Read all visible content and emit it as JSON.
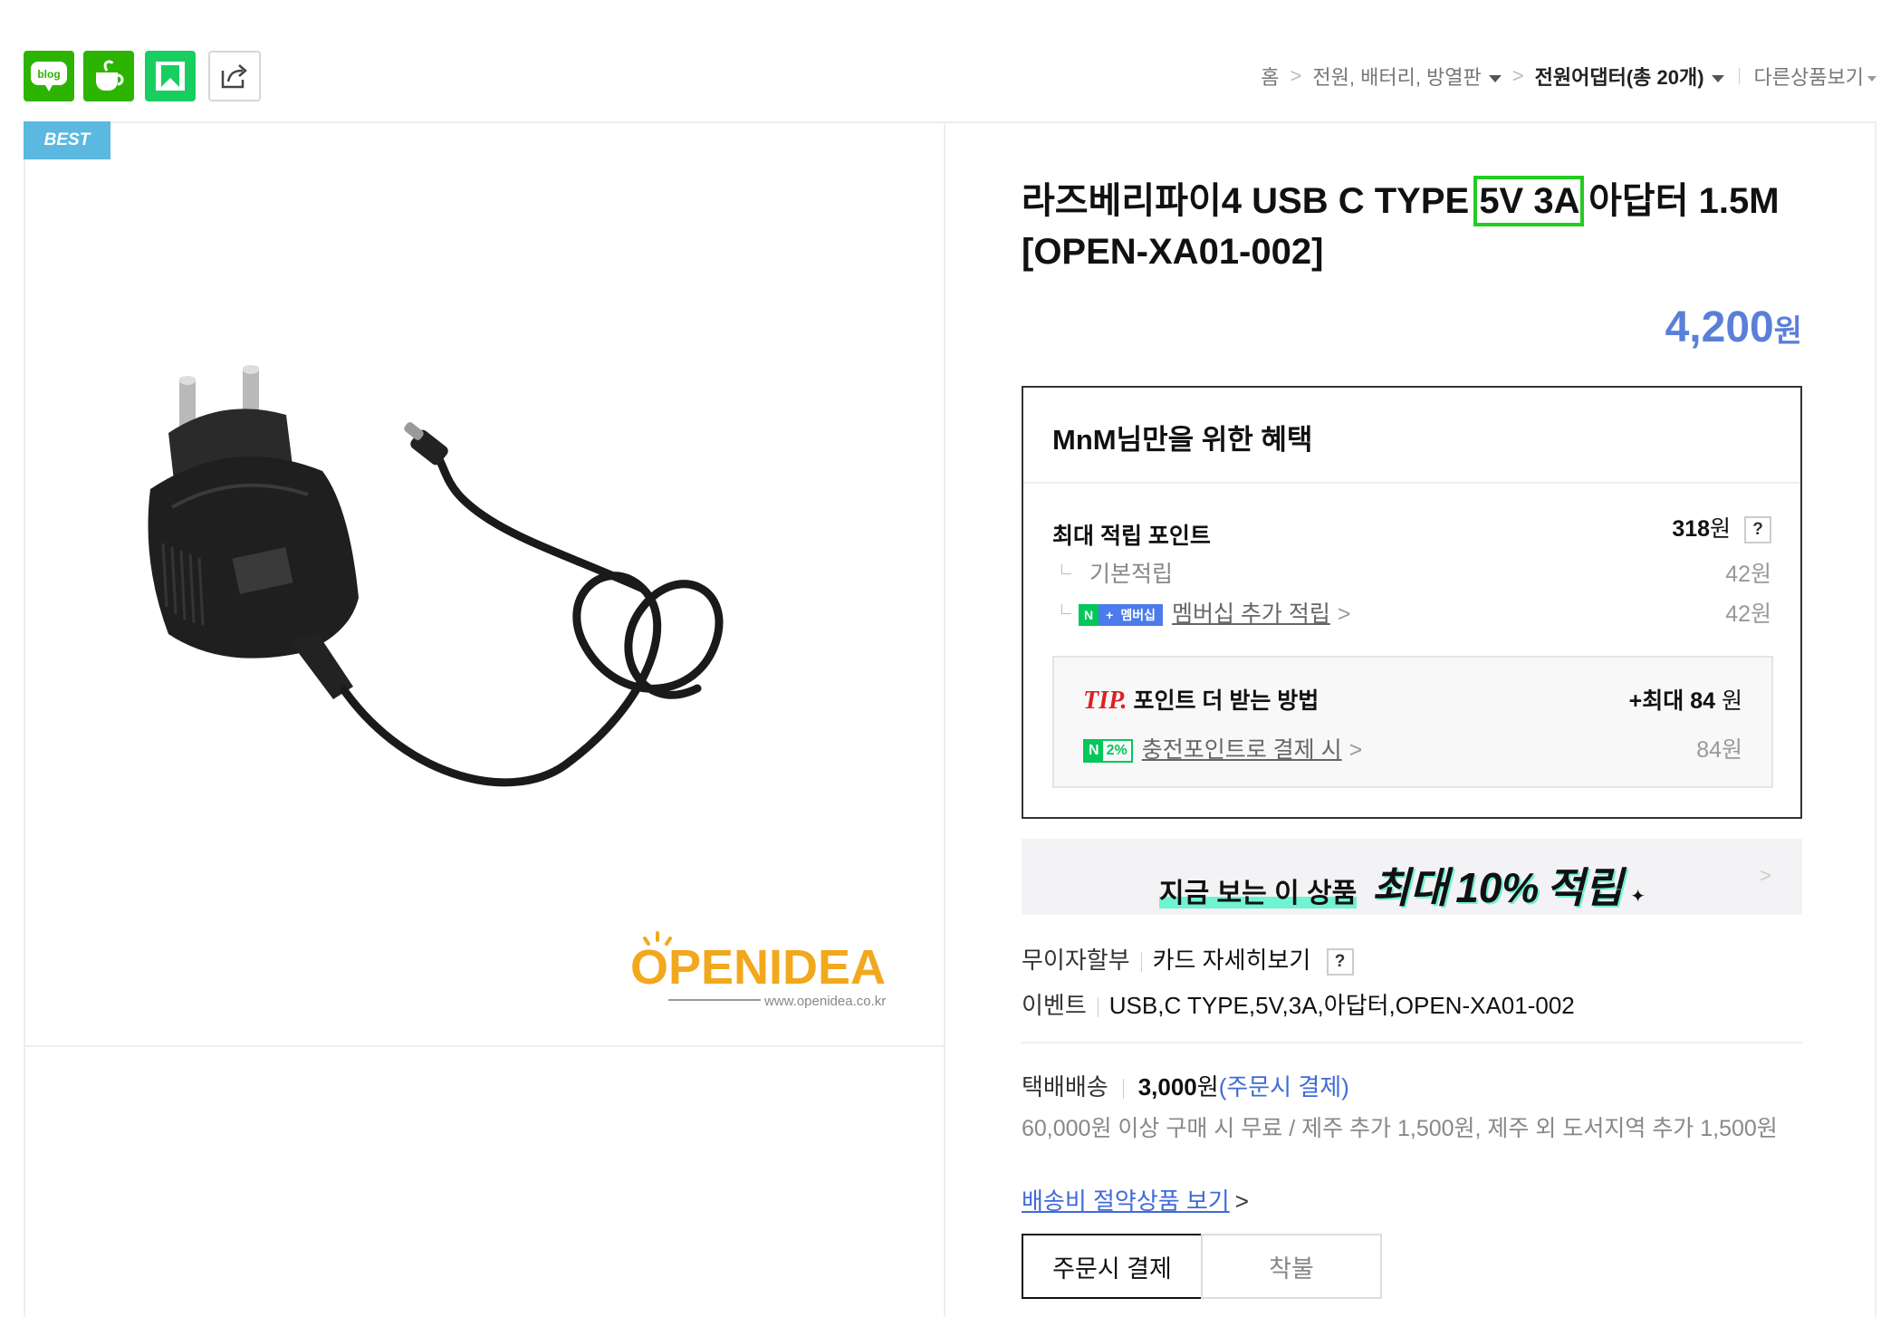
{
  "share": {
    "blog_label": "blog",
    "icons": [
      "blog-icon",
      "cafe-icon",
      "k-share-icon",
      "share-icon"
    ]
  },
  "breadcrumb": {
    "home": "홈",
    "category1": "전원, 배터리, 방열판",
    "category2": "전원어댑터(총 20개)",
    "more": "다른상품보기"
  },
  "badge": "BEST",
  "product": {
    "title_part1": "라즈베리파이4 USB C TYPE ",
    "title_highlight": "5V 3A",
    "title_part2": " 아답터 1.5M [OPEN-XA01-002]",
    "price": "4,200",
    "price_unit": "원"
  },
  "brand": {
    "name": "OPENIDEA",
    "url": "www.openidea.co.kr"
  },
  "benefits": {
    "header": "MnM님만을 위한 혜택",
    "max_points_label": "최대 적립 포인트",
    "max_points_value": "318",
    "max_points_unit": "원",
    "help": "?",
    "basic_label": "기본적립",
    "basic_value": "42원",
    "membership_pill_n": "N",
    "membership_pill_plus": "+",
    "membership_pill_text": "멤버십",
    "membership_label": "멤버십 추가 적립",
    "membership_value": "42원",
    "tip_label": "TIP.",
    "tip_title": "포인트 더 받는 방법",
    "tip_max_prefix": "+최대",
    "tip_max_value": "84",
    "tip_max_unit": "원",
    "charge_badge_n": "N",
    "charge_badge_pct": "2%",
    "charge_label": "충전포인트로 결제 시",
    "charge_value": "84원"
  },
  "banner": {
    "text": "지금 보는 이 상품",
    "max": "최대",
    "percent": "10%",
    "accrual": "적립"
  },
  "payment": {
    "installment_label": "무이자할부",
    "card_detail": "카드 자세히보기",
    "help": "?",
    "event_label": "이벤트",
    "event_value": "USB,C TYPE,5V,3A,아답터,OPEN-XA01-002"
  },
  "shipping": {
    "label": "택배배송",
    "fee": "3,000",
    "fee_unit": "원",
    "fee_note": "(주문시 결제)",
    "note": "60,000원 이상 구매 시 무료 / 제주 추가 1,500원, 제주 외 도서지역 추가 1,500원",
    "saving_link": "배송비 절약상품 보기",
    "option_prepaid": "주문시 결제",
    "option_cod": "착불"
  },
  "colors": {
    "price": "#5a7fd9",
    "naver_green": "#03c75a",
    "best_badge": "#5bb8e0",
    "highlight_box": "#22cc22"
  }
}
